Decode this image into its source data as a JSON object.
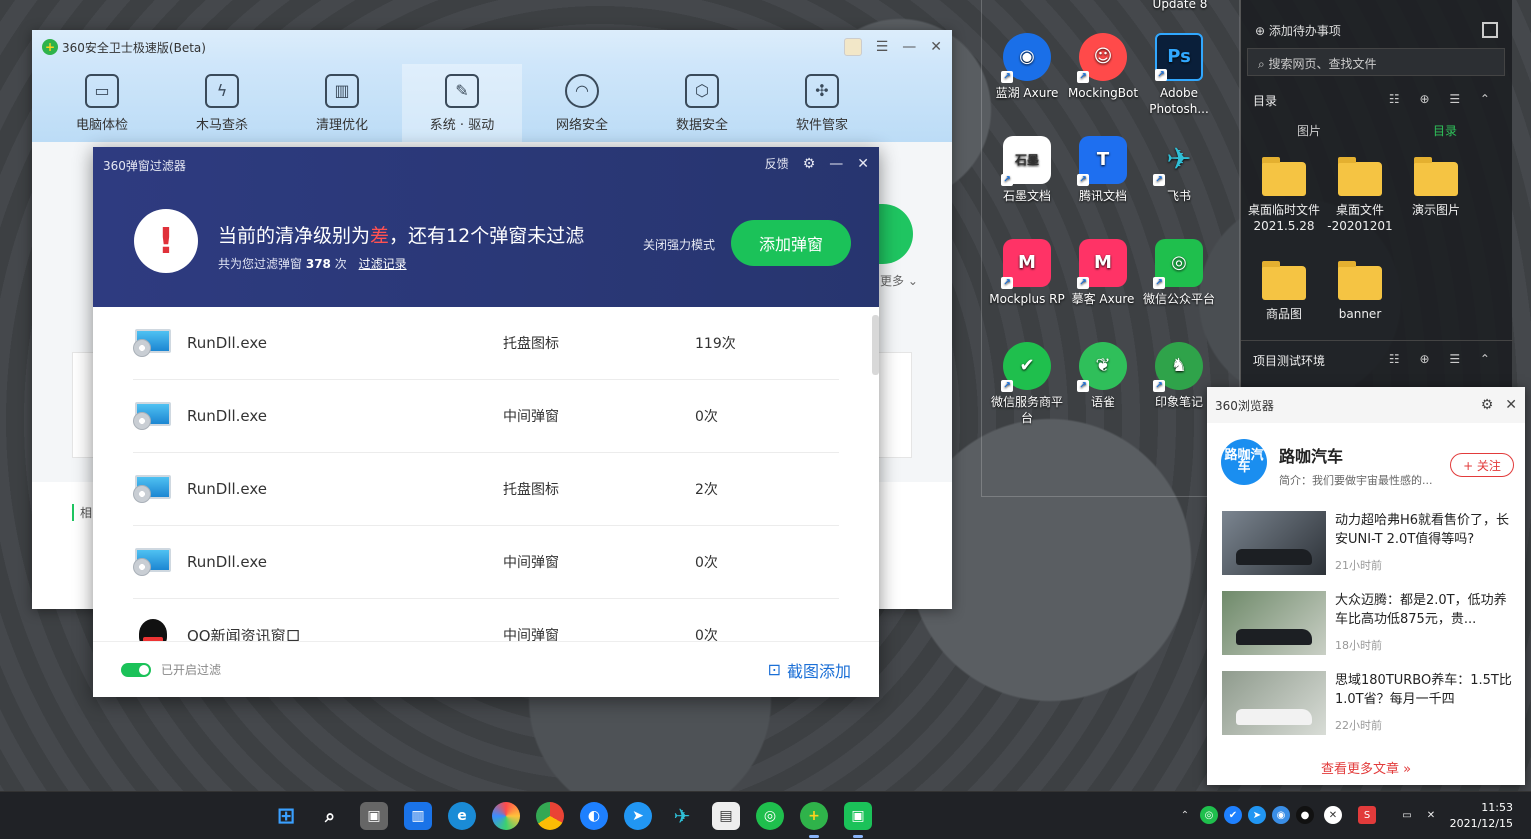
{
  "main_window": {
    "title": "360安全卫士极速版(Beta)",
    "tools": [
      {
        "label": "电脑体检",
        "icon": "monitor-check-icon"
      },
      {
        "label": "木马查杀",
        "icon": "shield-bolt-icon"
      },
      {
        "label": "清理优化",
        "icon": "broom-icon"
      },
      {
        "label": "系统 · 驱动",
        "icon": "wrench-icon"
      },
      {
        "label": "网络安全",
        "icon": "wifi-icon"
      },
      {
        "label": "数据安全",
        "icon": "cube-icon"
      },
      {
        "label": "软件管家",
        "icon": "apps-icon"
      }
    ],
    "more_text": "更多",
    "related_text": "相"
  },
  "filter": {
    "title": "360弹窗过滤器",
    "feedback": "反馈",
    "headline_prefix": "当前的清净级别为",
    "headline_level": "差",
    "headline_suffix": "，还有12个弹窗未过滤",
    "sub_prefix": "共为您过滤弹窗",
    "sub_count": "378",
    "sub_unit": "次",
    "sub_link": "过滤记录",
    "mode_toggle": "关闭强力模式",
    "add_button": "添加弹窗",
    "rows": [
      {
        "name": "RunDll.exe",
        "type": "托盘图标",
        "count": "119次",
        "icon": "monitor"
      },
      {
        "name": "RunDll.exe",
        "type": "中间弹窗",
        "count": "0次",
        "icon": "monitor"
      },
      {
        "name": "RunDll.exe",
        "type": "托盘图标",
        "count": "2次",
        "icon": "monitor"
      },
      {
        "name": "RunDll.exe",
        "type": "中间弹窗",
        "count": "0次",
        "icon": "monitor"
      },
      {
        "name": "QQ新闻资讯窗口",
        "type": "中间弹窗",
        "count": "0次",
        "icon": "qq"
      }
    ],
    "footer_toggle_label": "已开启过滤",
    "footer_screenshot": "截图添加"
  },
  "desktop_icons": [
    {
      "label": "Update 8",
      "color": "#2a2d31"
    },
    {
      "label": "蓝湖 Axure",
      "color": "#1a6fe8"
    },
    {
      "label": "MockingBot",
      "color": "#ff4a4a"
    },
    {
      "label": "Adobe Photosh...",
      "color": "#0a1f3a"
    },
    {
      "label": "石墨文档",
      "color": "#ffffff"
    },
    {
      "label": "腾讯文档",
      "color": "#1e6ff0"
    },
    {
      "label": "飞书",
      "color": "#2fbfd6"
    },
    {
      "label": "Mockplus RP",
      "color": "#ff3366"
    },
    {
      "label": "摹客 Axure",
      "color": "#ff3366"
    },
    {
      "label": "微信公众平台",
      "color": "#1fbf4d"
    },
    {
      "label": "微信服务商平台",
      "color": "#1fbf4d"
    },
    {
      "label": "语雀",
      "color": "#2fbf5a"
    },
    {
      "label": "印象笔记",
      "color": "#2fa34a"
    }
  ],
  "fence": {
    "todo": "添加待办事项",
    "search_placeholder": "搜索网页、查找文件",
    "section1": "目录",
    "tab_pictures": "图片",
    "tab_catalog": "目录",
    "folders": [
      {
        "label": "桌面临时文件 2021.5.28"
      },
      {
        "label": "桌面文件 -20201201"
      },
      {
        "label": "演示图片"
      },
      {
        "label": "商品图"
      },
      {
        "label": "banner"
      }
    ],
    "section2": "项目测试环境"
  },
  "news": {
    "window_title": "360浏览器",
    "brand_logo": "路咖汽车",
    "brand_name": "路咖汽车",
    "brand_desc": "简介：我们要做宇宙最性感的...",
    "follow": "+ 关注",
    "articles": [
      {
        "title": "动力超哈弗H6就看售价了，长安UNI-T 2.0T值得等吗?",
        "time": "21小时前"
      },
      {
        "title": "大众迈腾：都是2.0T，低功养车比高功低875元，贵...",
        "time": "18小时前"
      },
      {
        "title": "思域180TURBO养车：1.5T比1.0T省？每月一千四",
        "time": "22小时前"
      }
    ],
    "more": "查看更多文章 »"
  },
  "taskbar": {
    "time": "11:53",
    "date": "2021/12/15"
  }
}
